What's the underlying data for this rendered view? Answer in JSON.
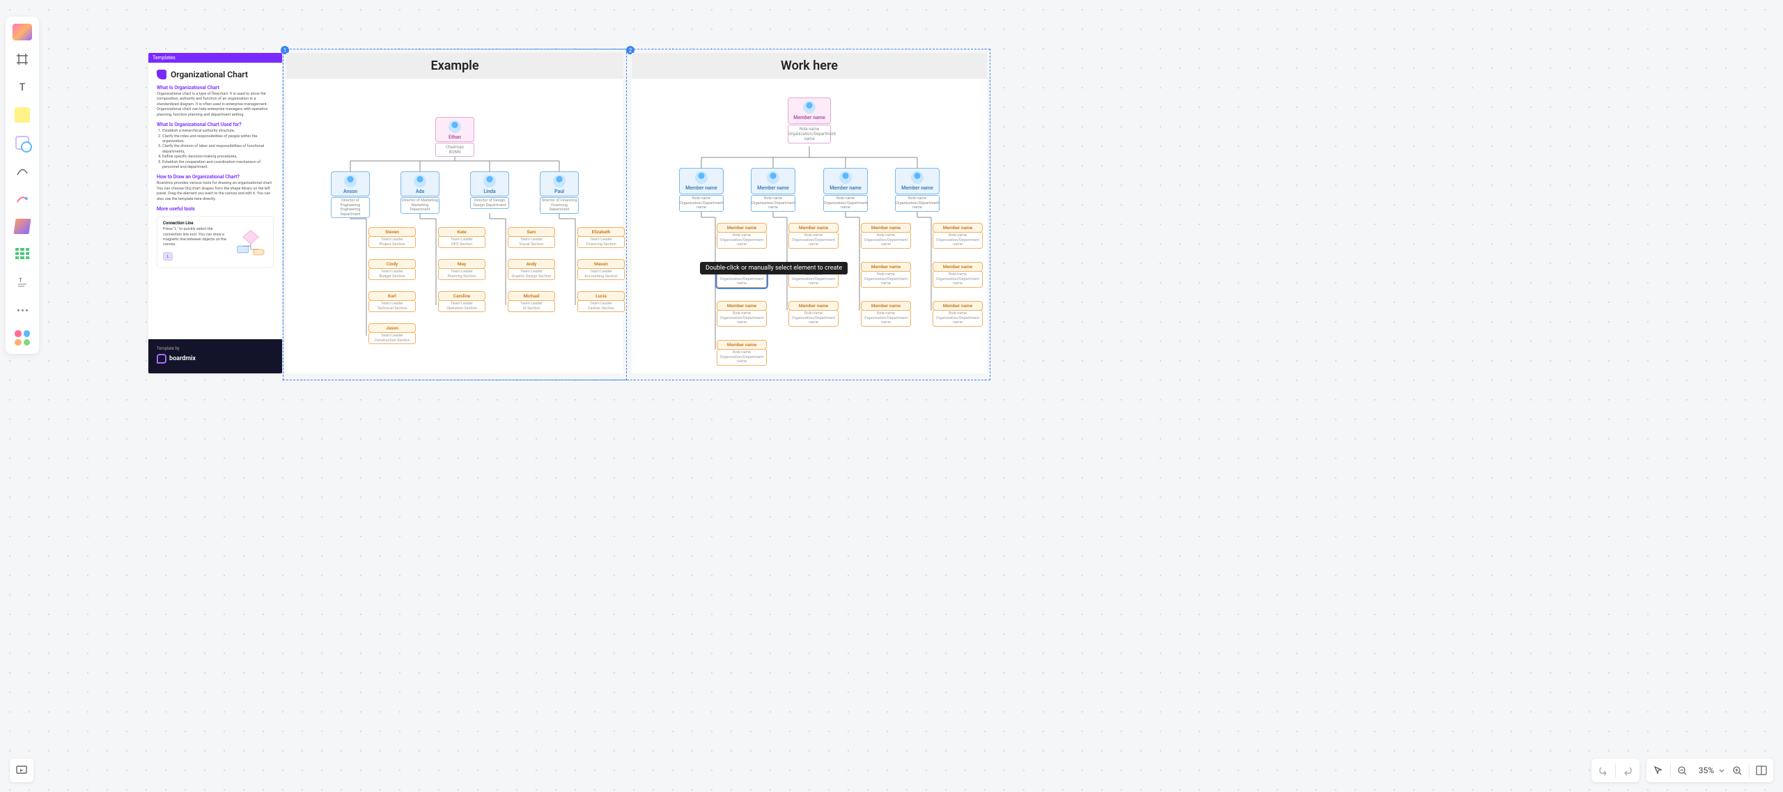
{
  "toolbar": {
    "items": [
      "frame",
      "text",
      "sticky",
      "shape",
      "line",
      "pen",
      "connection",
      "table",
      "textblock",
      "more",
      "apps"
    ]
  },
  "present_label": "Present",
  "bottom_right": {
    "undo": "Undo",
    "redo": "Redo",
    "cursor": "Select",
    "zoom_out": "Zoom out",
    "zoom_pct": "35%",
    "zoom_in": "Zoom in",
    "map": "Mini map"
  },
  "info": {
    "head": "Templates",
    "title": "Organizational Chart",
    "h1": "What Is Organizational Chart",
    "p1": "Organizational chart is a type of flowchart. It is used to show the composition, authority and function of an organization in a standardized diagram. It is often used in enterprise management. Organizational chart can help enterprise managers with operation planning, function planning and department setting.",
    "h2": "What Is Organizational Chart Used for?",
    "li1": "Establish a hierarchical authority structure,",
    "li2": "Clarify the roles and responsibilities of people within the organization,",
    "li3": "Clarify the division of labor and responsibilities of functional departments,",
    "li4": "Define specific decision-making procedures,",
    "li5": "Establish the cooperation and coordination mechanism of personnel and department.",
    "h3": "How to Draw an Organizational Chart?",
    "p3": "Boardmix provides various tools for drawing an organizational chart. You can choose Org chart shapes from the shape library on the left panel. Drag the element you want to the canvas and edit it. You can also use the template here directly.",
    "h4": "More useful tools",
    "mini_title": "Connection Line",
    "mini_p": "Press \"L\" to quickly select the connection line tool. You can draw a magnetic line between objects on the canvas.",
    "mini_key": "L",
    "foot_small": "Template by",
    "brand": "boardmix"
  },
  "frames": {
    "example": {
      "num": "1",
      "title": "Example"
    },
    "work": {
      "num": "2",
      "title": "Work here"
    }
  },
  "tooltip": "Double-click or manually select element to create",
  "example": {
    "top": {
      "name": "Ethan",
      "role": "Chairman",
      "dept": "BONN"
    },
    "dirs": [
      {
        "name": "Anson",
        "role": "Director of Engineering",
        "dept": "Engineering Department"
      },
      {
        "name": "Ada",
        "role": "Director of Marketing",
        "dept": "Marketing Department"
      },
      {
        "name": "Linda",
        "role": "Director of Design",
        "dept": "Design Department"
      },
      {
        "name": "Paul",
        "role": "Director of Financing",
        "dept": "Financing Department"
      }
    ],
    "cols": [
      [
        {
          "name": "Steven",
          "role": "Team Leader",
          "sec": "Project Section"
        },
        {
          "name": "Cindy",
          "role": "Team Leader",
          "sec": "Budget Section"
        },
        {
          "name": "Karl",
          "role": "Team Leader",
          "sec": "Technical Section"
        },
        {
          "name": "Jason",
          "role": "Team Leader",
          "sec": "Construction Section"
        }
      ],
      [
        {
          "name": "Kate",
          "role": "Team Leader",
          "sec": "OPS Section"
        },
        {
          "name": "May",
          "role": "Team Leader",
          "sec": "Planning Section"
        },
        {
          "name": "Caroline",
          "role": "Team Leader",
          "sec": "Operation Section"
        }
      ],
      [
        {
          "name": "Sam",
          "role": "Team Leader",
          "sec": "Visual Section"
        },
        {
          "name": "Andy",
          "role": "Team Leader",
          "sec": "Graphic Design Section"
        },
        {
          "name": "Michael",
          "role": "Team Leader",
          "sec": "UI Section"
        }
      ],
      [
        {
          "name": "Elizabeth",
          "role": "Team Leader",
          "sec": "Financing Section"
        },
        {
          "name": "Mason",
          "role": "Team Leader",
          "sec": "Accounting Section"
        },
        {
          "name": "Lucia",
          "role": "Team Leader",
          "sec": "Cashier Section"
        }
      ]
    ]
  },
  "work": {
    "top": {
      "name": "Member name",
      "role": "Role name",
      "dept": "Organization/Department name"
    },
    "dir": {
      "name": "Member name",
      "role": "Role name",
      "dept": "Organization/Department name"
    },
    "leaf": {
      "name": "Member name",
      "role": "Role name",
      "dept": "Organization/Department name"
    },
    "col_counts": [
      4,
      3,
      3,
      3
    ]
  }
}
